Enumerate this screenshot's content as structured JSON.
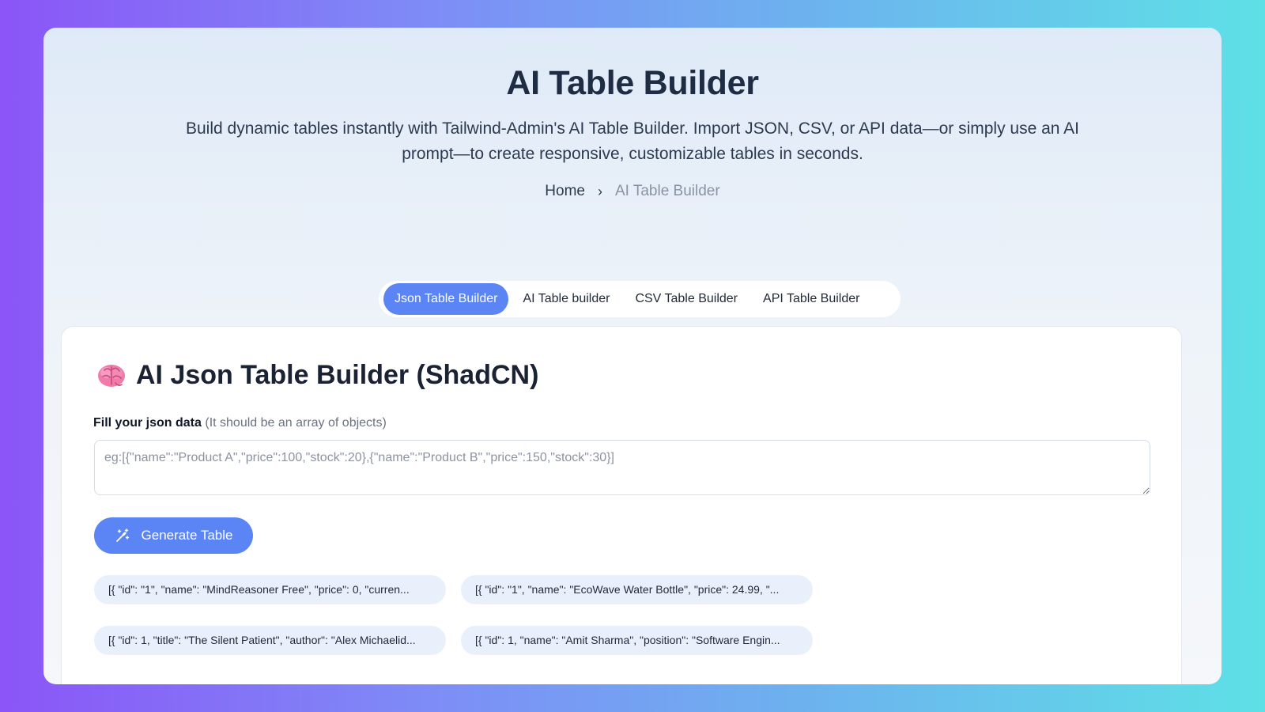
{
  "hero": {
    "title": "AI Table Builder",
    "description": "Build dynamic tables instantly with Tailwind-Admin's AI Table Builder. Import JSON, CSV, or API data—or simply use an AI prompt—to create responsive, customizable tables in seconds."
  },
  "breadcrumb": {
    "home": "Home",
    "separator": "›",
    "current": "AI Table Builder"
  },
  "tabs": [
    {
      "label": "Json Table Builder",
      "active": true
    },
    {
      "label": "AI Table builder",
      "active": false
    },
    {
      "label": "CSV Table Builder",
      "active": false
    },
    {
      "label": "API Table Builder",
      "active": false
    }
  ],
  "card": {
    "title": "AI Json Table Builder (ShadCN)",
    "title_icon": "brain-icon",
    "field_label": "Fill your json data",
    "field_hint": "(It should be an array of objects)",
    "input_placeholder": "eg:[{\"name\":\"Product A\",\"price\":100,\"stock\":20},{\"name\":\"Product B\",\"price\":150,\"stock\":30}]",
    "input_value": "",
    "generate_label": "Generate Table",
    "generate_icon": "magic-wand-icon",
    "samples": [
      "[{ \"id\": \"1\", \"name\": \"MindReasoner Free\", \"price\": 0, \"curren...",
      "[{ \"id\": \"1\", \"name\": \"EcoWave Water Bottle\", \"price\": 24.99, \"...",
      "[{ \"id\": 1, \"title\": \"The Silent Patient\", \"author\": \"Alex Michaelid...",
      "[{ \"id\": 1, \"name\": \"Amit Sharma\", \"position\": \"Software Engin..."
    ]
  },
  "colors": {
    "accent": "#5b84f5",
    "title": "#1f2d44",
    "chip_bg": "#eaf0fb"
  }
}
